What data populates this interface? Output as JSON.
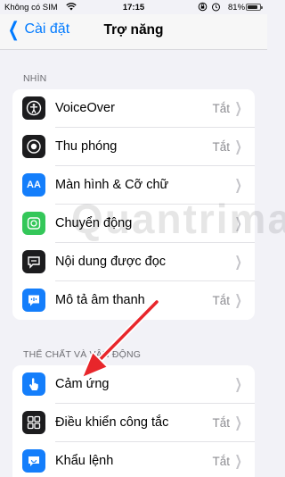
{
  "status_bar": {
    "carrier": "Không có SIM",
    "time": "17:15",
    "battery": "81%",
    "battery_level": 0.81
  },
  "nav": {
    "back_label": "Cài đặt",
    "title": "Trợ năng"
  },
  "sections": [
    {
      "header": "NHÌN",
      "items": [
        {
          "label": "VoiceOver",
          "value": "Tắt",
          "icon": "voiceover-icon",
          "color": "#1c1c1e"
        },
        {
          "label": "Thu phóng",
          "value": "Tắt",
          "icon": "zoom-icon",
          "color": "#1c1c1e"
        },
        {
          "label": "Màn hình & Cỡ chữ",
          "value": "",
          "icon": "text-size-icon",
          "color": "#147efb"
        },
        {
          "label": "Chuyển động",
          "value": "",
          "icon": "motion-icon",
          "color": "#34c759"
        },
        {
          "label": "Nội dung được đọc",
          "value": "",
          "icon": "spoken-content-icon",
          "color": "#1c1c1e"
        },
        {
          "label": "Mô tả âm thanh",
          "value": "Tắt",
          "icon": "audio-description-icon",
          "color": "#147efb"
        }
      ]
    },
    {
      "header": "THỂ CHẤT VÀ VẬN ĐỘNG",
      "items": [
        {
          "label": "Cảm ứng",
          "value": "",
          "icon": "touch-icon",
          "color": "#147efb"
        },
        {
          "label": "Điều khiển công tắc",
          "value": "Tắt",
          "icon": "switch-control-icon",
          "color": "#1c1c1e"
        },
        {
          "label": "Khẩu lệnh",
          "value": "Tắt",
          "icon": "voice-control-icon",
          "color": "#147efb"
        }
      ]
    }
  ],
  "watermark": "Quantrimang"
}
